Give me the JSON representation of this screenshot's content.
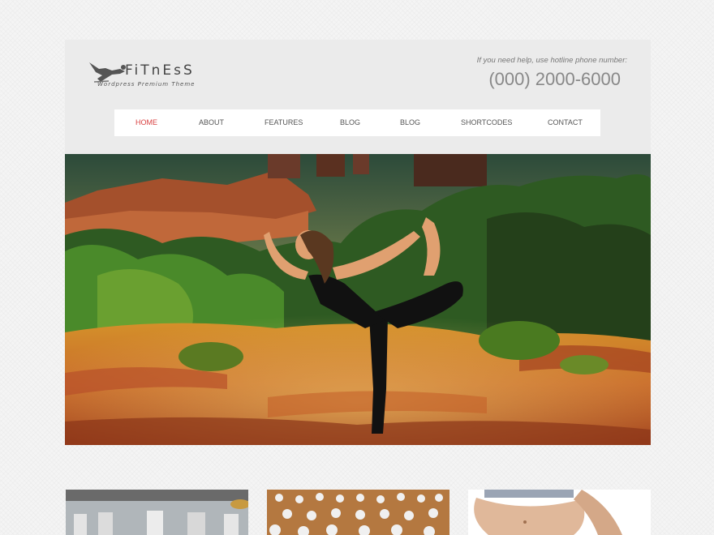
{
  "header": {
    "logo": {
      "name": "FiTnEsS",
      "tagline": "Wordpress Premium Theme",
      "figure_icon": "yoga-figure-icon"
    },
    "help_text": "If you need help, use hotline phone number:",
    "phone": "(000) 2000-6000"
  },
  "nav": {
    "items": [
      {
        "label": "HOME",
        "active": true
      },
      {
        "label": "ABOUT",
        "active": false
      },
      {
        "label": "FEATURES",
        "active": false
      },
      {
        "label": "BLOG",
        "active": false
      },
      {
        "label": "BLOG",
        "active": false
      },
      {
        "label": "SHORTCODES",
        "active": false
      },
      {
        "label": "CONTACT",
        "active": false
      }
    ],
    "active_color": "#d94040"
  },
  "hero": {
    "image": "woman-yoga-dancer-pose-red-rocks-photo"
  },
  "thumbnails": [
    {
      "image": "gym-interior-photo"
    },
    {
      "image": "yoga-class-crowd-photo"
    },
    {
      "image": "pregnant-belly-photo"
    }
  ]
}
